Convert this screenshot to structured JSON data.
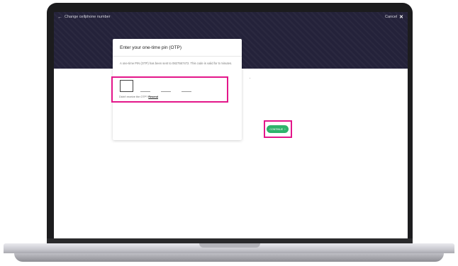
{
  "topbar": {
    "back_label": "Change cellphone number",
    "cancel_label": "Cancel"
  },
  "card": {
    "title": "Enter your one-time pin (OTP)",
    "body": "A one-time PIN (OTP) has been sent to 0827557472. This code is valid for 5 minutes.",
    "resend_prefix": "Didn't receive the OTP?",
    "resend_link": "Resend",
    "continue_label": "CONTINUE"
  },
  "icons": {
    "back": "arrow-left-icon",
    "close": "close-icon",
    "continue": "chevron-right-icon"
  },
  "colors": {
    "highlight": "#e3168a",
    "primary_button": "#2fb36b",
    "hero": "#24223a"
  }
}
